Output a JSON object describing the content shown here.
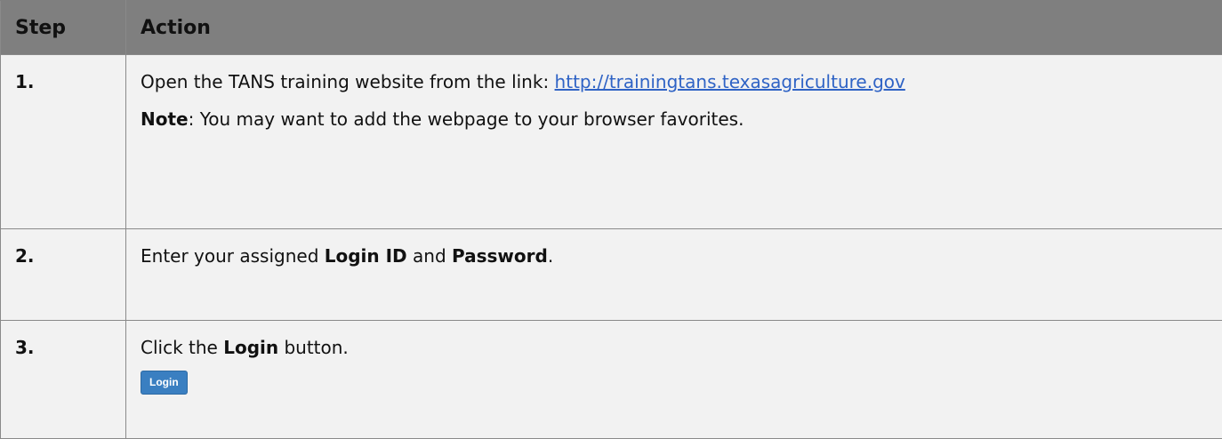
{
  "table": {
    "headers": {
      "step": "Step",
      "action": "Action"
    },
    "rows": [
      {
        "step": "1.",
        "action": {
          "line1_text": "Open the TANS training website from the link: ",
          "line1_link": "http://trainingtans.texasagriculture.gov",
          "note_label": "Note",
          "note_text": ": You may want to add the webpage to your browser favorites."
        }
      },
      {
        "step": "2.",
        "action": {
          "text_a": "Enter your assigned ",
          "bold_a": "Login ID",
          "text_b": " and ",
          "bold_b": "Password",
          "text_c": "."
        }
      },
      {
        "step": "3.",
        "action": {
          "text_a": "Click the ",
          "bold_a": "Login",
          "text_b": " button.",
          "button_label": "Login"
        }
      }
    ]
  },
  "colors": {
    "header_bg": "#7f7f7f",
    "cell_bg": "#f2f2f2",
    "link": "#2f63c5",
    "button_bg": "#3a7fc1"
  }
}
